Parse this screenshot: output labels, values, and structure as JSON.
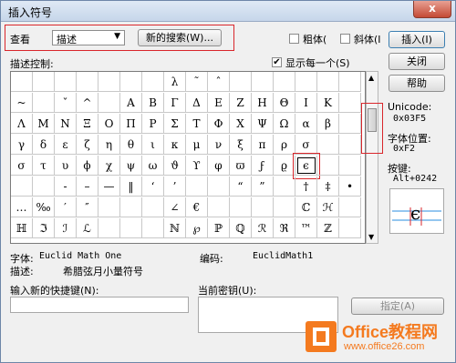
{
  "window": {
    "title": "插入符号",
    "close_glyph": "x"
  },
  "toolbar": {
    "view_label": "查看",
    "view_value": "描述",
    "search_button": "新的搜索(W)...",
    "bold_label": "粗体(",
    "italic_label": "斜体(I",
    "insert_button": "插入(I)",
    "close_button": "关闭",
    "help_button": "帮助"
  },
  "symbols": {
    "grid_label": "描述控制:",
    "show_each_label": "显示每一个(S)",
    "show_each_checked": true,
    "rows": [
      [
        "",
        "",
        "",
        "",
        "",
        "",
        "",
        "λ",
        "˜",
        "ˆ",
        "",
        "",
        ""
      ],
      [
        "~",
        "",
        "ˇ",
        "^",
        "",
        "A",
        "B",
        "Γ",
        "Δ",
        "E",
        "Z",
        "H",
        "Θ",
        "I",
        "K"
      ],
      [
        "Λ",
        "M",
        "N",
        "Ξ",
        "O",
        "Π",
        "P",
        "Σ",
        "T",
        "Φ",
        "X",
        "Ψ",
        "Ω",
        "α",
        "β"
      ],
      [
        "γ",
        "δ",
        "ε",
        "ζ",
        "η",
        "θ",
        "ι",
        "κ",
        "μ",
        "ν",
        "ξ",
        "π",
        "ρ",
        "σ",
        ""
      ],
      [
        "σ",
        "τ",
        "υ",
        "ϕ",
        "χ",
        "ψ",
        "ω",
        "ϑ",
        "ϒ",
        "φ",
        "ϖ",
        "ϝ",
        "ϱ",
        "ϵ",
        ""
      ],
      [
        "",
        "",
        "-",
        "–",
        "—",
        "‖",
        "‘",
        "’",
        "",
        "",
        "“",
        "”",
        "",
        "†",
        "‡",
        "•"
      ],
      [
        "…",
        "‰",
        "′",
        "″",
        "",
        "",
        "",
        "∠",
        "€",
        "",
        "",
        "",
        "",
        "ℂ",
        "ℋ"
      ],
      [
        "ℍ",
        "ℑ",
        "ℐ",
        "ℒ",
        "",
        "",
        "",
        "ℕ",
        "℘",
        "ℙ",
        "ℚ",
        "ℛ",
        "ℜ",
        "™",
        "ℤ"
      ]
    ],
    "selected_symbol": "ϵ"
  },
  "details": {
    "unicode_label": "Unicode:",
    "unicode_value": "0x03F5",
    "font_pos_label": "字体位置:",
    "font_pos_value": "0xF2",
    "key_label": "按键:",
    "key_value": "Alt+0242",
    "font_label": "字体:",
    "font_value": "Euclid Math One",
    "code_label": "编码:",
    "code_value": "EuclidMath1",
    "desc_label": "描述:",
    "desc_value": "希腊弦月小量符号"
  },
  "shortcut": {
    "new_label": "输入新的快捷键(N):",
    "current_label": "当前密钥(U):",
    "assign_button": "指定(A)"
  },
  "watermark": {
    "name": "Office教程网",
    "url": "www.office26.com"
  },
  "colors": {
    "highlight": "#d9262b",
    "watermark": "#f47a1f"
  }
}
